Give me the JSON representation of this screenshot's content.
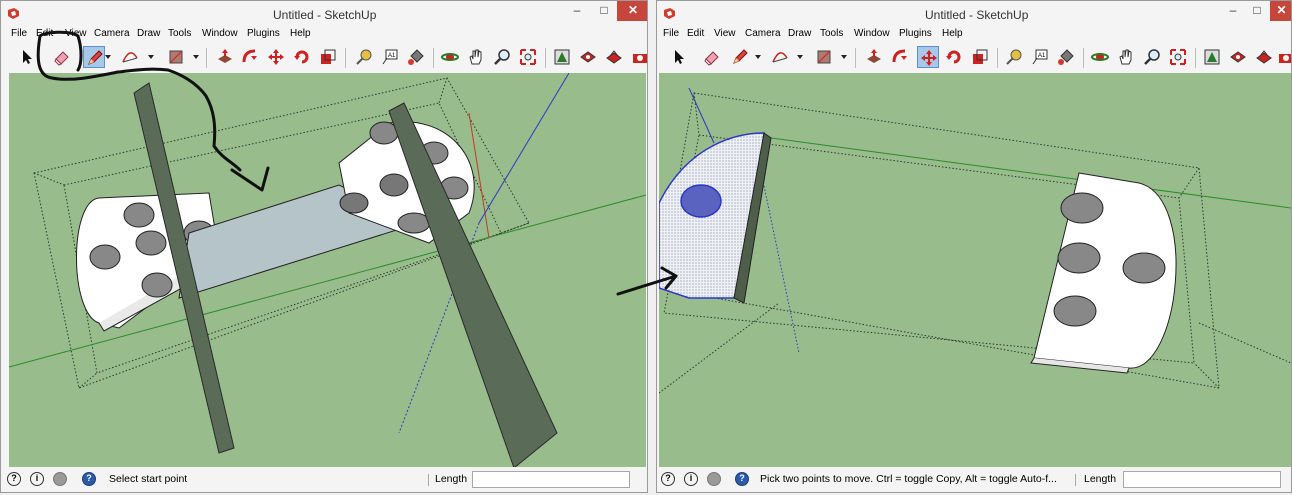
{
  "left": {
    "title": "Untitled - SketchUp",
    "menu": [
      "File",
      "Edit",
      "View",
      "Camera",
      "Draw",
      "Tools",
      "Window",
      "Plugins",
      "Help"
    ],
    "status_text": "Select start point",
    "length_label": "Length",
    "length_value": ""
  },
  "right": {
    "title": "Untitled - SketchUp",
    "menu": [
      "File",
      "Edit",
      "View",
      "Camera",
      "Draw",
      "Tools",
      "Window",
      "Plugins",
      "Help"
    ],
    "status_text": "Pick two points to move.  Ctrl = toggle Copy, Alt = toggle Auto-f...",
    "length_label": "Length",
    "length_value": ""
  },
  "window_controls": {
    "minimize": "–",
    "maximize": "□",
    "close": "✕"
  },
  "toolbar_icons": [
    "select-icon",
    "eraser-icon",
    "pencil-icon",
    "arc-icon",
    "rectangle-icon",
    "pushpull-icon",
    "followme-icon",
    "move-icon",
    "rotate-icon",
    "scale-icon",
    "tape-measure-icon",
    "text-icon",
    "paint-bucket-icon",
    "orbit-icon",
    "pan-icon",
    "zoom-icon",
    "zoom-extents-icon",
    "components-icon",
    "materials-icon",
    "styles-icon"
  ],
  "colors": {
    "viewport": "#98bc8c",
    "selection": "#a8c8ea",
    "close": "#c7463c",
    "axis_red": "#c23b2a",
    "axis_green": "#2f8a2c",
    "axis_blue": "#2a38c4"
  }
}
